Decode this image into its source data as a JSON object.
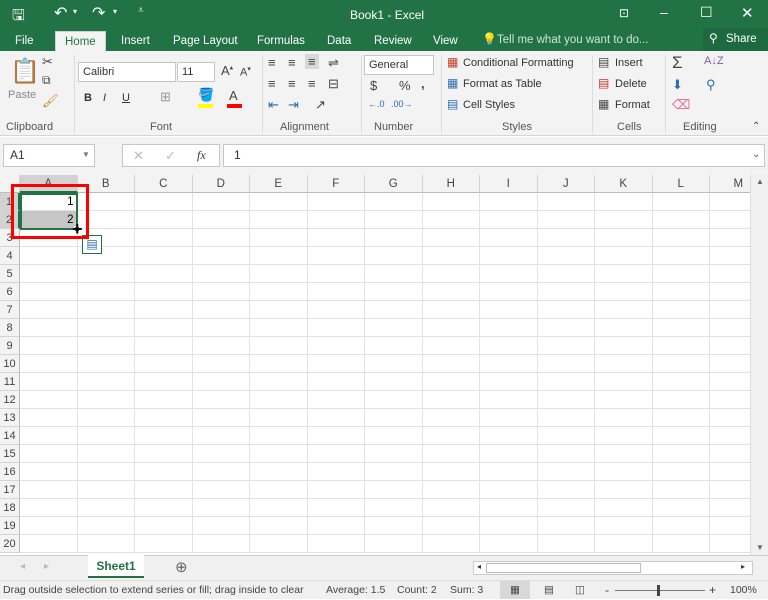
{
  "app": {
    "title": "Book1 - Excel",
    "accent": "#217346"
  },
  "qat": {
    "save": "save-icon",
    "undo": "undo-icon",
    "redo": "redo-icon"
  },
  "tabs": [
    {
      "label": "File"
    },
    {
      "label": "Home",
      "active": true
    },
    {
      "label": "Insert"
    },
    {
      "label": "Page Layout"
    },
    {
      "label": "Formulas"
    },
    {
      "label": "Data"
    },
    {
      "label": "Review"
    },
    {
      "label": "View"
    }
  ],
  "tell_me": "Tell me what you want to do...",
  "share": "Share",
  "ribbon": {
    "clipboard": {
      "label": "Clipboard",
      "paste": "Paste"
    },
    "font": {
      "label": "Font",
      "name": "Calibri",
      "size": "11",
      "bold": "B",
      "italic": "I",
      "underline": "U",
      "fill_color": "#ffff00",
      "font_color": "#ff0000"
    },
    "alignment": {
      "label": "Alignment"
    },
    "number": {
      "label": "Number",
      "format": "General",
      "currency": "$",
      "percent": "%",
      "comma": ","
    },
    "styles": {
      "label": "Styles",
      "conditional": "Conditional Formatting",
      "table": "Format as Table",
      "cell_styles": "Cell Styles"
    },
    "cells": {
      "label": "Cells",
      "insert": "Insert",
      "delete": "Delete",
      "format": "Format"
    },
    "editing": {
      "label": "Editing",
      "sum": "Σ"
    }
  },
  "formula_bar": {
    "name_box": "A1",
    "cancel": "✕",
    "enter": "✓",
    "fx": "fx",
    "value": "1"
  },
  "columns": [
    "A",
    "B",
    "C",
    "D",
    "E",
    "F",
    "G",
    "H",
    "I",
    "J",
    "K",
    "L",
    "M"
  ],
  "rows": [
    "1",
    "2",
    "3",
    "4",
    "5",
    "6",
    "7",
    "8",
    "9",
    "10",
    "11",
    "12",
    "13",
    "14",
    "15",
    "16",
    "17",
    "18",
    "19",
    "20"
  ],
  "cells": {
    "A1": "1",
    "A2": "2"
  },
  "sheets": [
    {
      "label": "Sheet1",
      "active": true
    }
  ],
  "status": {
    "message": "Drag outside selection to extend series or fill; drag inside to clear",
    "average": "Average: 1.5",
    "count": "Count: 2",
    "sum": "Sum: 3",
    "zoom": "100%",
    "zoom_minus": "-",
    "zoom_plus": "+"
  },
  "annotation_color": "#ff0000"
}
